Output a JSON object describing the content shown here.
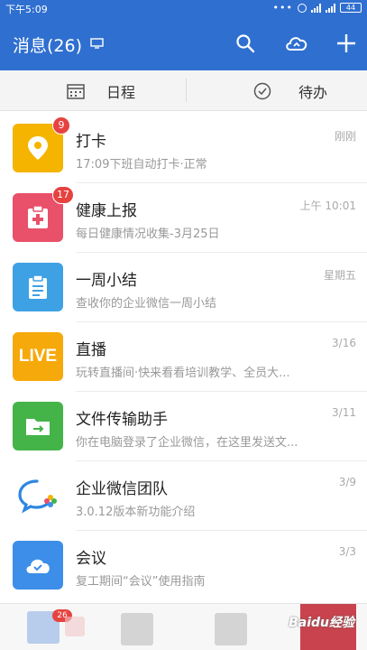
{
  "status": {
    "time": "下午5:09",
    "dots": "•••",
    "battery": "44"
  },
  "header": {
    "title": "消息(26)"
  },
  "subtabs": [
    {
      "label": "日程"
    },
    {
      "label": "待办"
    }
  ],
  "messages": [
    {
      "name": "打卡",
      "sub": "17:09下班自动打卡·正常",
      "time": "刚刚",
      "badge": "9",
      "color": "#f4b400",
      "icon": "location-pin-icon"
    },
    {
      "name": "健康上报",
      "sub": "每日健康情况收集-3月25日",
      "time": "上午 10:01",
      "badge": "17",
      "color": "#e9506a",
      "icon": "health-report-icon"
    },
    {
      "name": "一周小结",
      "sub": "查收你的企业微信一周小结",
      "time": "星期五",
      "badge": "",
      "color": "#3ea1e4",
      "icon": "clipboard-icon"
    },
    {
      "name": "直播",
      "sub": "玩转直播间·快来看看培训教学、全员大...",
      "time": "3/16",
      "badge": "",
      "color": "#f6a90a",
      "icon": "live-icon",
      "icon_text": "LIVE"
    },
    {
      "name": "文件传输助手",
      "sub": "你在电脑登录了企业微信，在这里发送文...",
      "time": "3/11",
      "badge": "",
      "color": "#44b449",
      "icon": "folder-icon"
    },
    {
      "name": "企业微信团队",
      "sub": "3.0.12版本新功能介绍",
      "time": "3/9",
      "badge": "",
      "color": "#ffffff",
      "icon": "wework-logo-icon"
    },
    {
      "name": "会议",
      "sub": "复工期间“会议”使用指南",
      "time": "3/3",
      "badge": "",
      "color": "#3c8ee8",
      "icon": "meeting-icon"
    }
  ],
  "bottom_nav": {
    "badge": "26",
    "watermark": "Baidu经验"
  }
}
